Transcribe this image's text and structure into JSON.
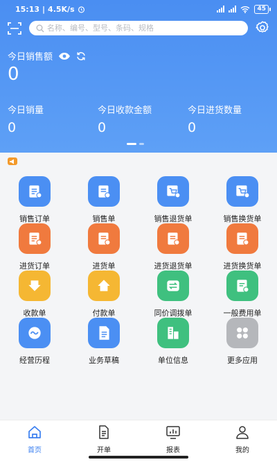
{
  "status_bar": {
    "time": "15:13",
    "speed": "4.5K/s",
    "battery": "45"
  },
  "search": {
    "placeholder": "名称、编号、型号、条码、规格"
  },
  "dashboard": {
    "sales_label": "今日销售额",
    "sales_value": "0",
    "stats": [
      {
        "label": "今日销量",
        "value": "0"
      },
      {
        "label": "今日收款金额",
        "value": "0"
      },
      {
        "label": "今日进货数量",
        "value": "0"
      }
    ]
  },
  "menu": [
    {
      "label": "销售订单",
      "icon": "sales-order-icon",
      "color": "#4b8ff3"
    },
    {
      "label": "销售单",
      "icon": "sales-bill-icon",
      "color": "#4b8ff3"
    },
    {
      "label": "销售退货单",
      "icon": "sales-return-icon",
      "color": "#4b8ff3"
    },
    {
      "label": "销售换货单",
      "icon": "sales-exchange-icon",
      "color": "#4b8ff3"
    },
    {
      "label": "进货订单",
      "icon": "purchase-order-icon",
      "color": "#f07a3e"
    },
    {
      "label": "进货单",
      "icon": "purchase-bill-icon",
      "color": "#f07a3e"
    },
    {
      "label": "进货退货单",
      "icon": "purchase-return-icon",
      "color": "#f07a3e"
    },
    {
      "label": "进货换货单",
      "icon": "purchase-exchange-icon",
      "color": "#f07a3e"
    },
    {
      "label": "收款单",
      "icon": "receipt-icon",
      "color": "#f5b733"
    },
    {
      "label": "付款单",
      "icon": "payment-icon",
      "color": "#f5b733"
    },
    {
      "label": "同价调拨单",
      "icon": "transfer-icon",
      "color": "#3fc07f"
    },
    {
      "label": "一般费用单",
      "icon": "expense-icon",
      "color": "#3fc07f"
    },
    {
      "label": "经营历程",
      "icon": "history-icon",
      "color": "#4b8ff3"
    },
    {
      "label": "业务草稿",
      "icon": "draft-icon",
      "color": "#4b8ff3"
    },
    {
      "label": "单位信息",
      "icon": "unit-info-icon",
      "color": "#3fc07f"
    },
    {
      "label": "更多应用",
      "icon": "more-apps-icon",
      "color": "#b5b7bb"
    }
  ],
  "tabs": [
    {
      "label": "首页",
      "icon": "home-icon",
      "active": true
    },
    {
      "label": "开单",
      "icon": "create-bill-icon",
      "active": false
    },
    {
      "label": "报表",
      "icon": "report-icon",
      "active": false
    },
    {
      "label": "我的",
      "icon": "profile-icon",
      "active": false
    }
  ],
  "colors": {
    "header": "#4a8ef2",
    "active_tab": "#3a7ff0"
  }
}
